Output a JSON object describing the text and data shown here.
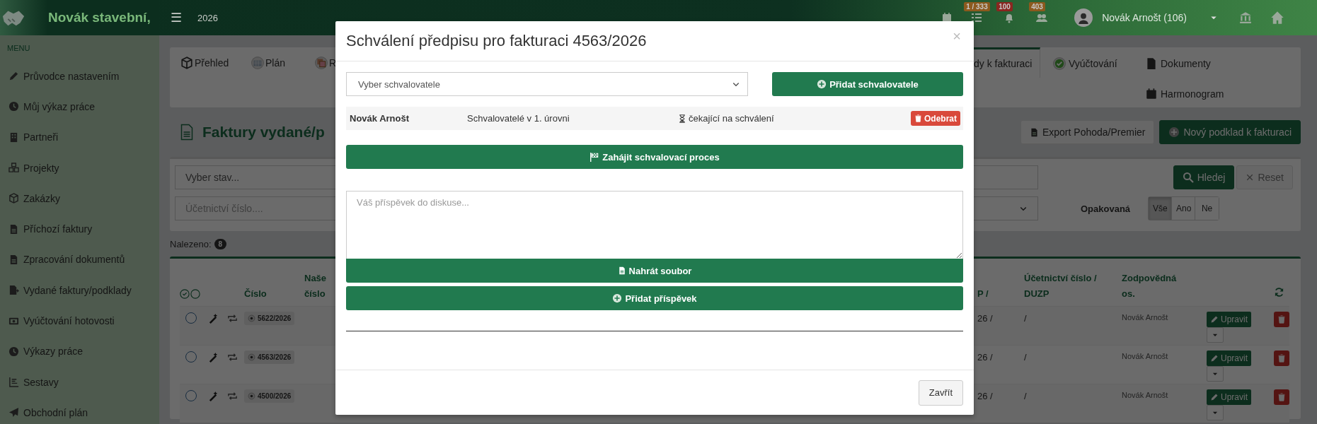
{
  "topbar": {
    "brand": "Novák stavební,",
    "menu_toggle": "☰",
    "year": "2026",
    "notifications": [
      {
        "count": "1 / 333",
        "color": "#8c5a1e"
      },
      {
        "count": "100",
        "color": "#8a2620"
      },
      {
        "count": "403",
        "color": "#8c5a1e"
      }
    ],
    "user": "Novák Arnošt (106)"
  },
  "sidebar": {
    "heading": "MENU",
    "items": [
      {
        "label": "Průvodce nastavením"
      },
      {
        "label": "Můj výkaz práce"
      },
      {
        "label": "Partneři"
      },
      {
        "label": "Projekty"
      },
      {
        "label": "Zakázky"
      },
      {
        "label": "Příchozí faktury"
      },
      {
        "label": "Zpracování dokumentů"
      },
      {
        "label": "Vydané faktury/podklady"
      },
      {
        "label": "Vyúčtování hotovosti"
      },
      {
        "label": "Výkazy práce"
      },
      {
        "label": "Sestavy"
      },
      {
        "label": "Obchodní plán"
      }
    ]
  },
  "tabs": [
    {
      "label": "Přehled",
      "selected": false
    },
    {
      "label": "Plán",
      "selected": false
    },
    {
      "label": "R",
      "selected": false
    },
    {
      "label": "dy k fakturaci",
      "selected": true
    },
    {
      "label": "Vyúčtování",
      "selected": false
    },
    {
      "label": "Dokumenty",
      "selected": false
    },
    {
      "label": "Harmonogram",
      "selected": false
    }
  ],
  "page": {
    "title": "Faktury vydané/p",
    "actions": [
      {
        "label": "Export Pohoda/Premier",
        "kind": "export"
      },
      {
        "label": "Nový podklad k fakturaci",
        "kind": "new"
      }
    ]
  },
  "filters": {
    "status_placeholder": "Vyber stav...",
    "number_placeholder": "Účetnictví číslo....",
    "search_button": "Hledej",
    "reset_button": "Reset",
    "repeat_label": "Opakovaná",
    "repeat_options": [
      {
        "label": "Vše",
        "selected": true
      },
      {
        "label": "Ano",
        "selected": false
      },
      {
        "label": "Ne",
        "selected": false
      }
    ]
  },
  "found": {
    "label": "Nalezeno:",
    "count": "8"
  },
  "table": {
    "columns": [
      "Číslo",
      "Naše číslo",
      "P /",
      "Účetnictví číslo / DUZP",
      "Zodpovědná os."
    ],
    "rows": [
      {
        "selected": false,
        "number": "5622/2026",
        "column_3": "26 /",
        "accounting": "/",
        "person": "Novák Arnošt",
        "edit": "Upravit"
      },
      {
        "selected": false,
        "number": "4563/2026",
        "column_3": "26 /",
        "accounting": "/",
        "person": "Novák Arnošt",
        "edit": "Upravit"
      },
      {
        "selected": false,
        "number": "4500/2026",
        "column_3": "26 /",
        "accounting": "/",
        "person": "Novák Arnošt",
        "edit": "Upravit"
      }
    ]
  },
  "modal": {
    "title": "Schválení předpisu pro fakturaci 4563/2026",
    "close": "×",
    "approver_select": "Vyber schvalovatele",
    "add_approver": "Přidat schvalovatele",
    "approvers": [
      {
        "name": "Novák Arnošt",
        "level": "Schvalovatelé v 1. úrovni",
        "status": "čekající na schválení",
        "remove": "Odebrat"
      }
    ],
    "start_button": "Zahájit schvalovací proces",
    "post_placeholder": "Váš příspěvek do diskuse...",
    "upload_button": "Nahrát soubor",
    "add_post_button": "Přidat příspěvek",
    "footer_button": "Zavřít"
  }
}
